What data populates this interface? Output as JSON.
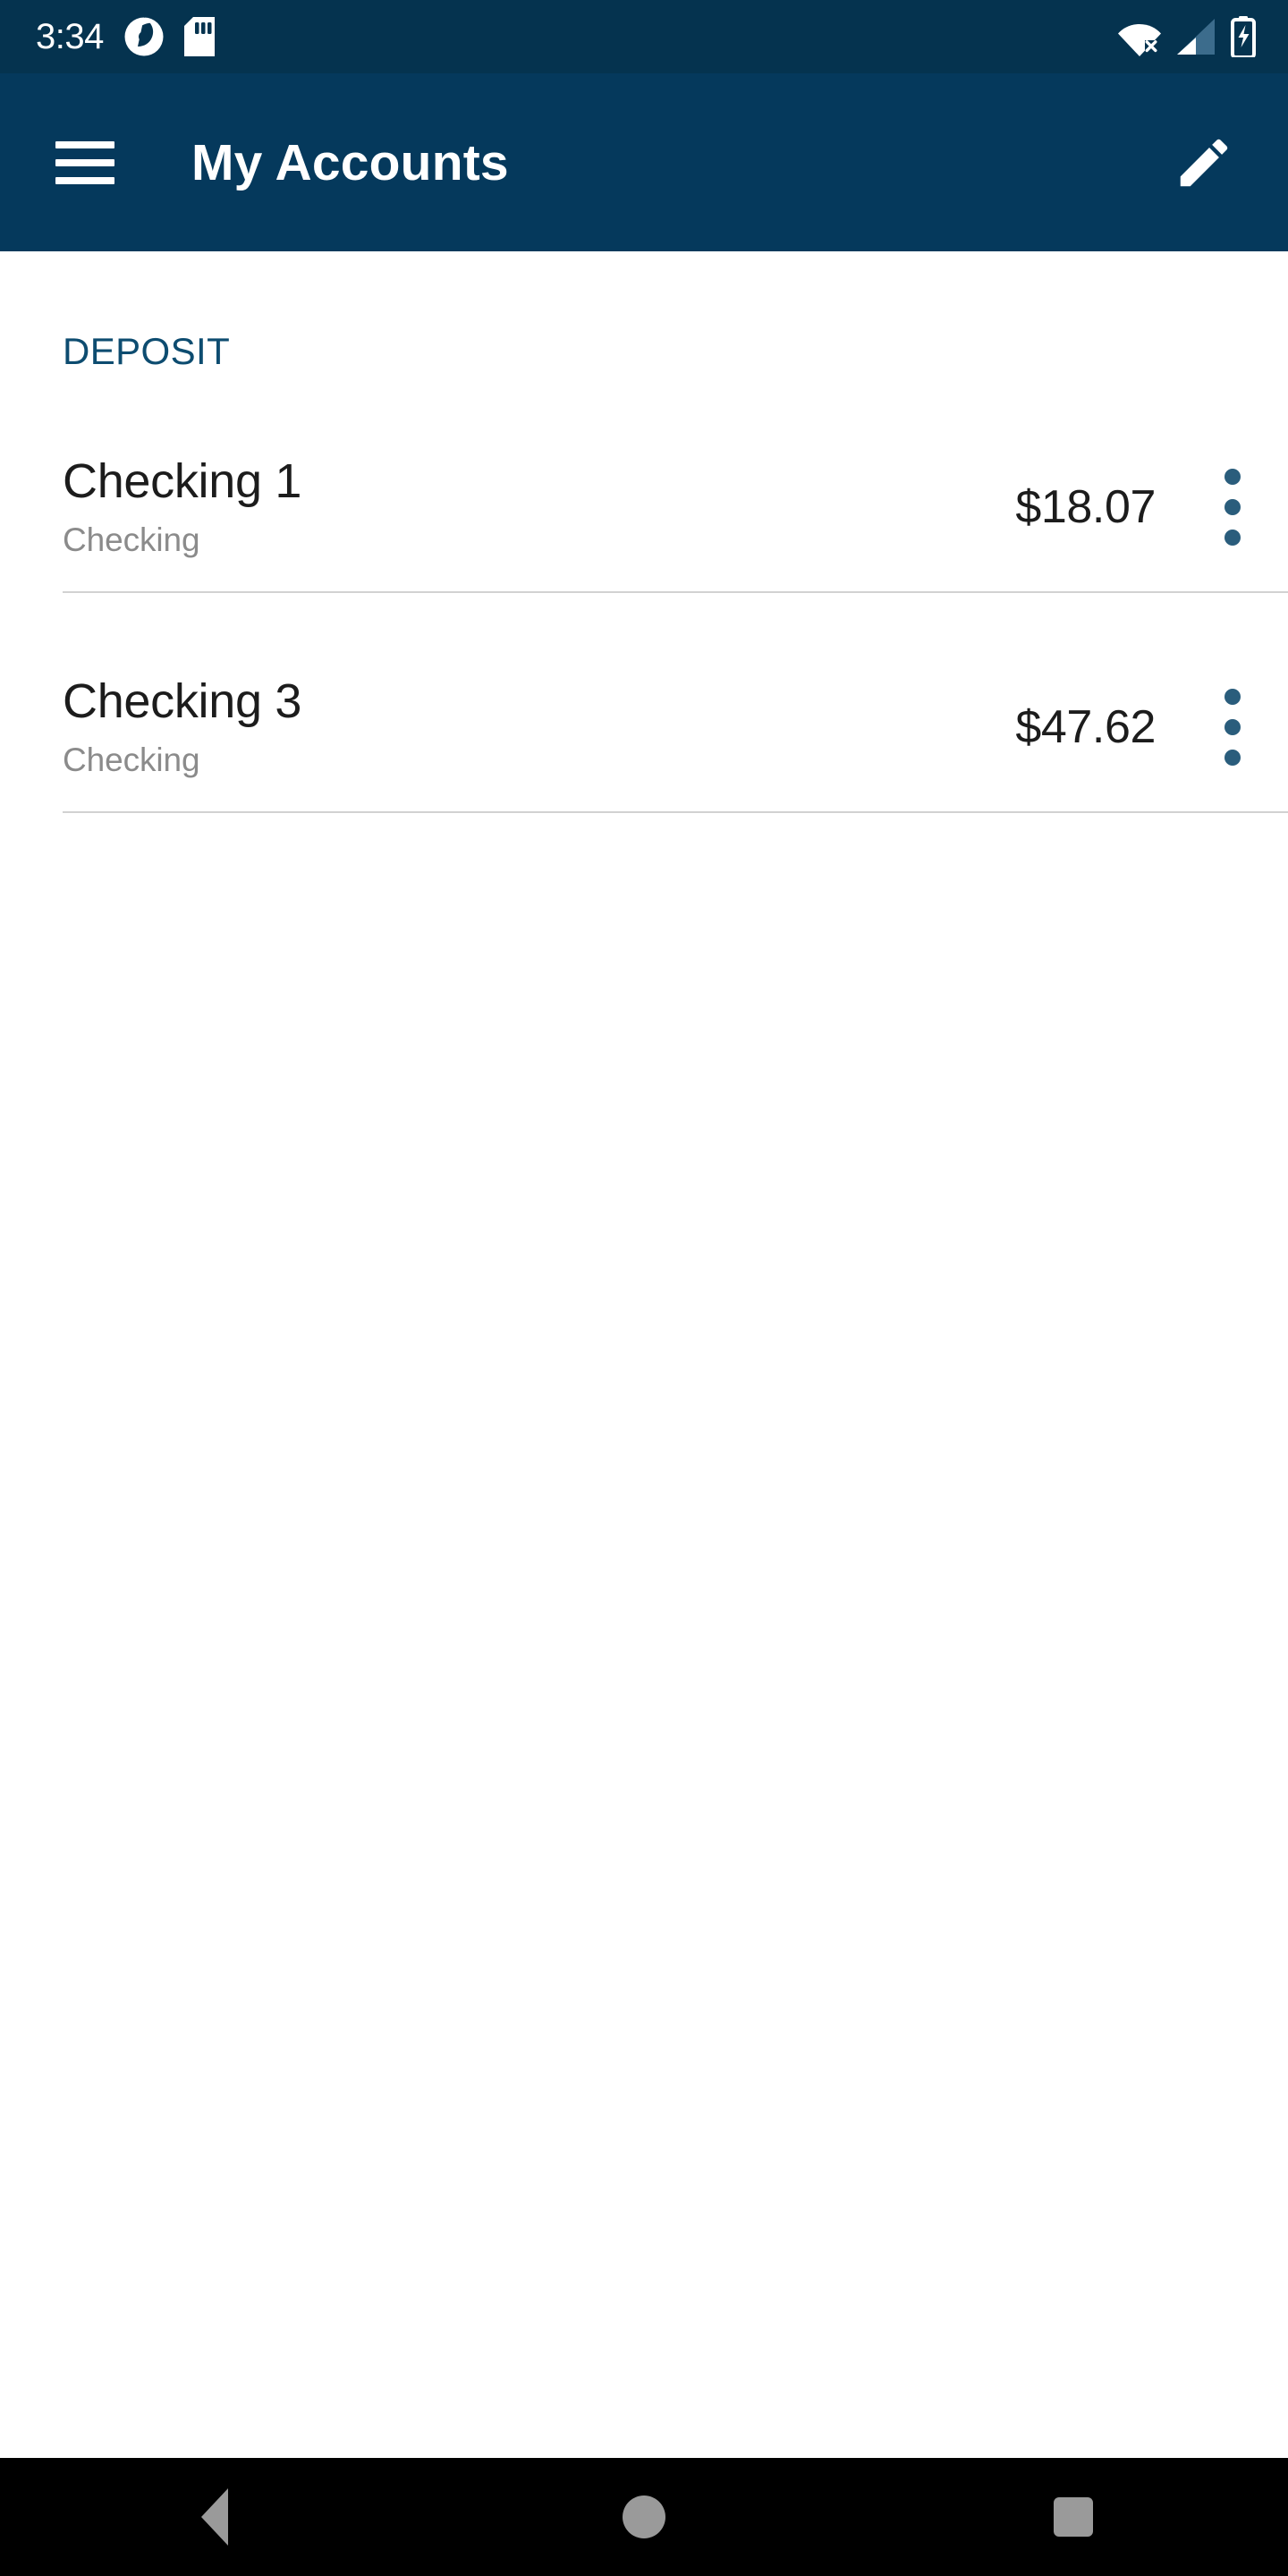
{
  "status_bar": {
    "time": "3:34",
    "icons": {
      "notification_logo": "app-logo-icon",
      "sd_card": "sd-card-icon",
      "wifi_off": "wifi-off-icon",
      "cellular": "cellular-signal-icon",
      "battery_charging": "battery-charging-icon"
    },
    "background_color": "#05334f"
  },
  "app_bar": {
    "title": "My Accounts",
    "menu_icon": "hamburger-menu-icon",
    "edit_icon": "pencil-edit-icon",
    "background_color": "#05395c",
    "text_color": "#ffffff"
  },
  "main": {
    "section_label": "DEPOSIT",
    "section_label_color": "#0d4c70",
    "accounts": [
      {
        "name": "Checking 1",
        "type": "Checking",
        "balance": "$18.07",
        "overflow_icon": "more-vertical-icon"
      },
      {
        "name": "Checking 3",
        "type": "Checking",
        "balance": "$47.62",
        "overflow_icon": "more-vertical-icon"
      }
    ],
    "accent_color": "#2a5d7c",
    "divider_color": "#d2d2d2"
  },
  "nav_bar": {
    "back_label": "back-button",
    "home_label": "home-button",
    "recents_label": "recents-button",
    "background_color": "#000000",
    "icon_color": "#9a9a9a"
  }
}
